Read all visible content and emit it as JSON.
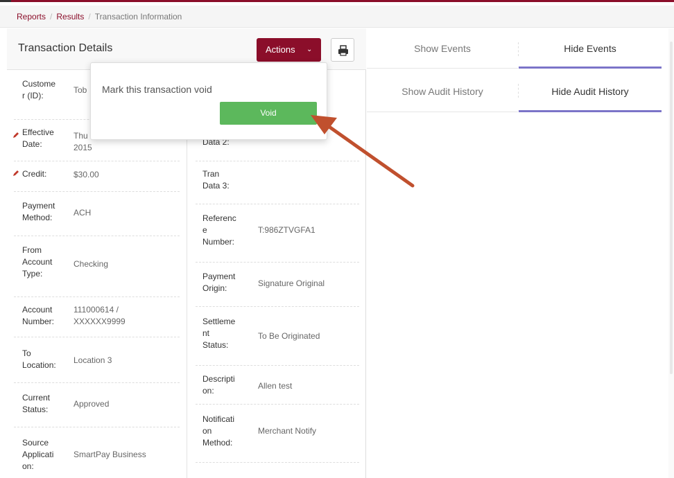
{
  "breadcrumb": {
    "reports": "Reports",
    "results": "Results",
    "current": "Transaction Information",
    "separator": "/"
  },
  "header": {
    "title": "Transaction Details",
    "actions_label": "Actions",
    "print_icon": "print-icon"
  },
  "fields_left": [
    {
      "label": "Custome\nr (ID):",
      "value": "Tob"
    },
    {
      "label": "Effective\nDate:",
      "value": "Thu\n2015",
      "editable": true
    },
    {
      "label": "Credit:",
      "value": "$30.00",
      "editable": true
    },
    {
      "label": "Payment\nMethod:",
      "value": "ACH"
    },
    {
      "label": "From\nAccount\nType:",
      "value": "Checking"
    },
    {
      "label": "Account\nNumber:",
      "value": "111000614 /\nXXXXXX9999"
    },
    {
      "label": "To\nLocation:",
      "value": "Location 3"
    },
    {
      "label": "Current\nStatus:",
      "value": "Approved"
    },
    {
      "label": "Source\nApplicati\non:",
      "value": "SmartPay Business"
    }
  ],
  "fields_right": [
    {
      "label": "Data 2:",
      "value": ""
    },
    {
      "label": "Tran\nData 3:",
      "value": ""
    },
    {
      "label": "Referenc\ne\nNumber:",
      "value": "T:986ZTVGFA1"
    },
    {
      "label": "Payment\nOrigin:",
      "value": "Signature Original"
    },
    {
      "label": "Settleme\nnt\nStatus:",
      "value": "To Be Originated"
    },
    {
      "label": "Descripti\non:",
      "value": "Allen test"
    },
    {
      "label": "Notificati\non\nMethod:",
      "value": "Merchant Notify"
    }
  ],
  "tabs": {
    "show_events": "Show Events",
    "hide_events": "Hide Events",
    "show_audit": "Show Audit History",
    "hide_audit": "Hide Audit History"
  },
  "popover": {
    "text": "Mark this transaction void",
    "void_label": "Void"
  },
  "colors": {
    "brand": "#8b0e2a",
    "void_green": "#5cb85c",
    "tab_underline": "#7b74c8",
    "arrow": "#c0502e"
  }
}
